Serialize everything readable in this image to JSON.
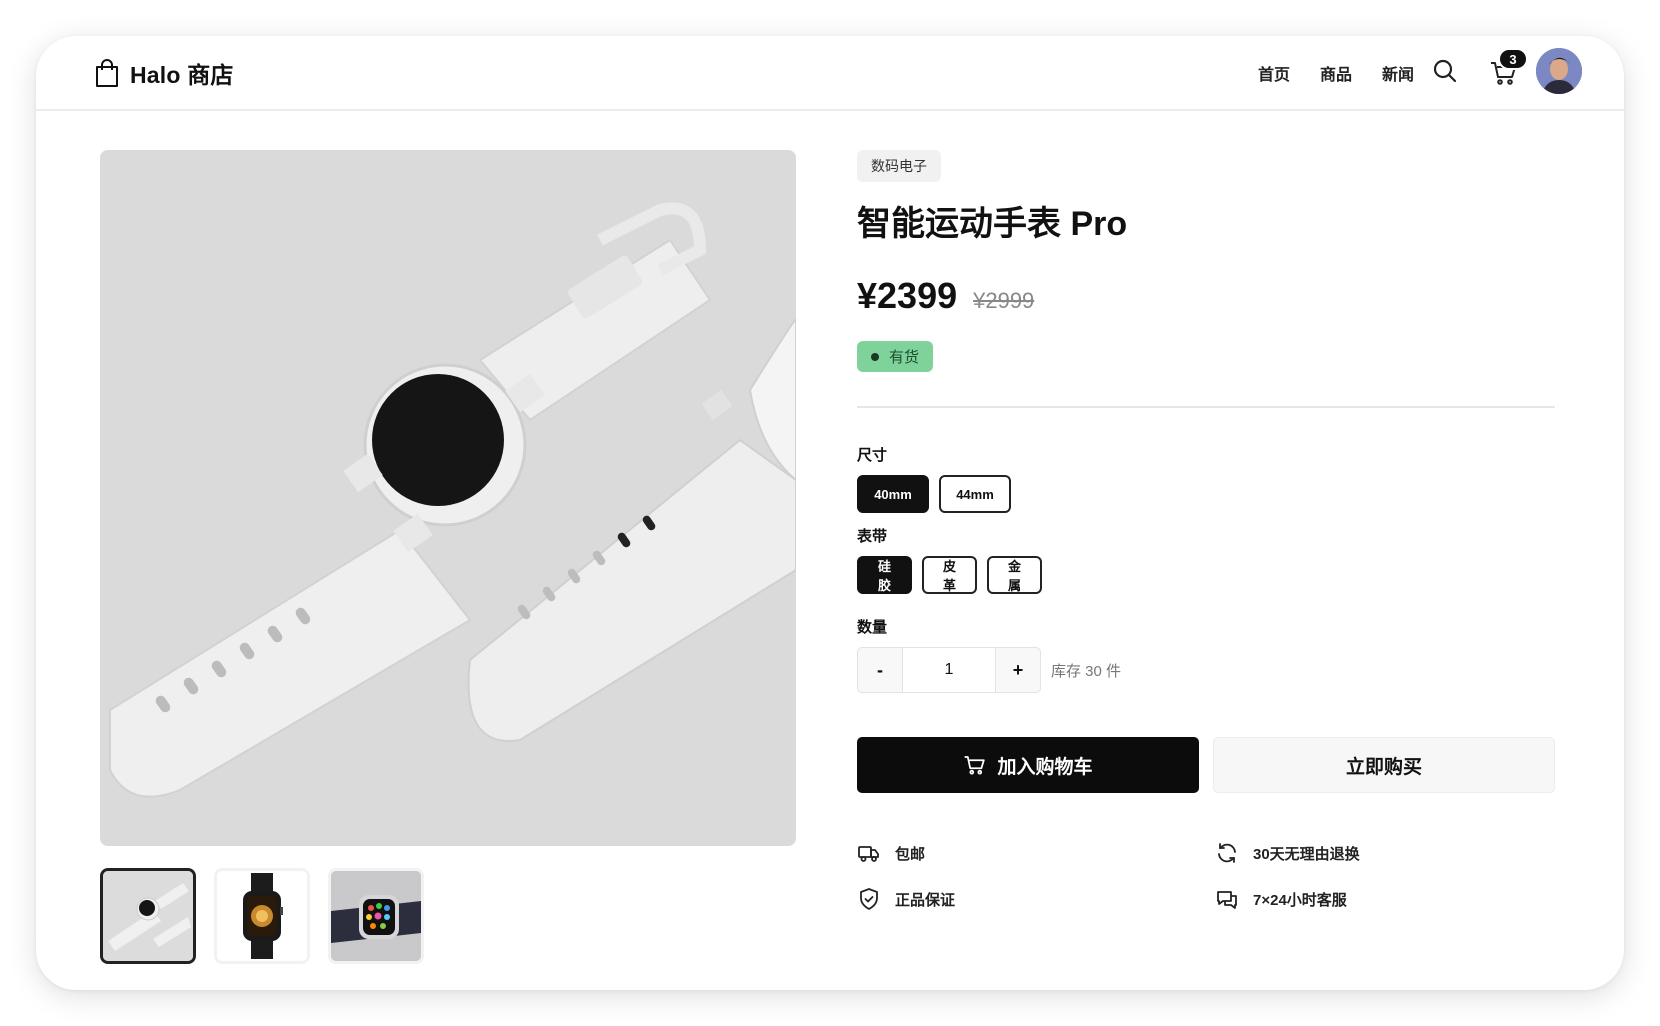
{
  "header": {
    "brand": "Halo 商店",
    "nav": [
      "首页",
      "商品",
      "新闻"
    ],
    "cart_count": "3",
    "icons": {
      "brand": "shopping-bag-icon",
      "search": "search-icon",
      "cart": "cart-icon"
    }
  },
  "gallery": {
    "main_image": "white-smartwatch-photo",
    "thumbnails": [
      "white-smartwatch-thumb",
      "black-watch-thumb",
      "apple-watch-thumb"
    ],
    "active_thumbnail": 0
  },
  "product": {
    "category": "数码电子",
    "title": "智能运动手表 Pro",
    "price": "¥2399",
    "original_price": "¥2999",
    "stock_status": "有货"
  },
  "options": {
    "size": {
      "label": "尺寸",
      "values": [
        "40mm",
        "44mm"
      ],
      "selected": "40mm"
    },
    "band": {
      "label": "表带",
      "values": [
        "硅胶",
        "皮革",
        "金属"
      ],
      "selected": "硅胶"
    },
    "quantity": {
      "label": "数量",
      "value": "1",
      "minus": "-",
      "plus": "+",
      "stock_text": "库存 30 件"
    }
  },
  "actions": {
    "add_to_cart": "加入购物车",
    "buy_now": "立即购买"
  },
  "features": [
    {
      "icon": "truck-icon",
      "text": "包邮"
    },
    {
      "icon": "refresh-icon",
      "text": "30天无理由退换"
    },
    {
      "icon": "shield-check-icon",
      "text": "正品保证"
    },
    {
      "icon": "chat-icon",
      "text": "7×24小时客服"
    }
  ],
  "colors": {
    "primary": "#0c0c0c",
    "stock_badge": "#7fd39a"
  }
}
